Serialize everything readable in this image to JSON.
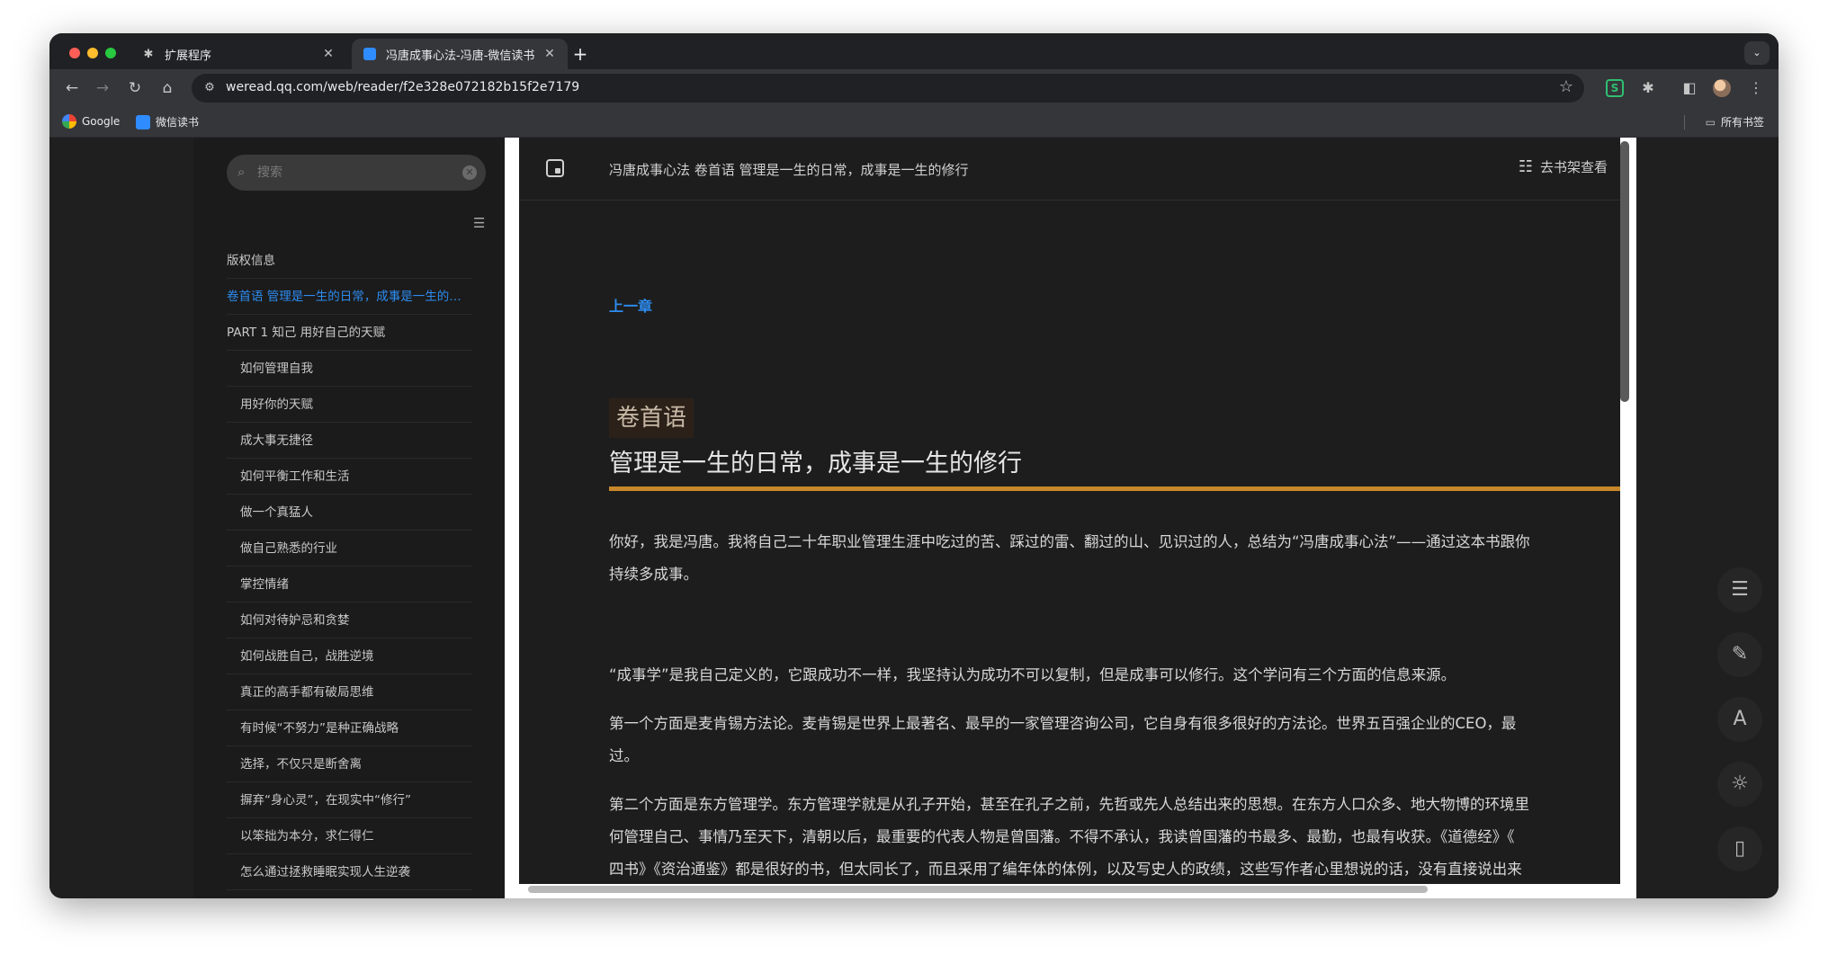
{
  "browser": {
    "tabs": [
      {
        "icon": "puzzle-icon",
        "title": "扩展程序"
      },
      {
        "icon": "weread-icon",
        "title": "冯唐成事心法-冯唐-微信读书"
      }
    ],
    "new_tab": "+",
    "url": "weread.qq.com/web/reader/f2e328e072182b15f2e7179",
    "bookmarks": [
      {
        "icon": "google-icon",
        "label": "Google"
      },
      {
        "icon": "weread-icon",
        "label": "微信读书"
      }
    ],
    "bookmarks_folder": "所有书签"
  },
  "sidebar": {
    "search_placeholder": "搜索",
    "toc": [
      {
        "label": "版权信息",
        "level": 0,
        "active": false
      },
      {
        "label": "卷首语 管理是一生的日常，成事是一生的修行",
        "level": 0,
        "active": true
      },
      {
        "label": "PART 1 知己 用好自己的天赋",
        "level": 0,
        "active": false
      },
      {
        "label": "如何管理自我",
        "level": 1,
        "active": false
      },
      {
        "label": "用好你的天赋",
        "level": 1,
        "active": false
      },
      {
        "label": "成大事无捷径",
        "level": 1,
        "active": false
      },
      {
        "label": "如何平衡工作和生活",
        "level": 1,
        "active": false
      },
      {
        "label": "做一个真猛人",
        "level": 1,
        "active": false
      },
      {
        "label": "做自己熟悉的行业",
        "level": 1,
        "active": false
      },
      {
        "label": "掌控情绪",
        "level": 1,
        "active": false
      },
      {
        "label": "如何对待妒忌和贪婪",
        "level": 1,
        "active": false
      },
      {
        "label": "如何战胜自己，战胜逆境",
        "level": 1,
        "active": false
      },
      {
        "label": "真正的高手都有破局思维",
        "level": 1,
        "active": false
      },
      {
        "label": "有时候“不努力”是种正确战略",
        "level": 1,
        "active": false
      },
      {
        "label": "选择，不仅只是断舍离",
        "level": 1,
        "active": false
      },
      {
        "label": "摒弃“身心灵”，在现实中“修行”",
        "level": 1,
        "active": false
      },
      {
        "label": "以笨拙为本分，求仁得仁",
        "level": 1,
        "active": false
      },
      {
        "label": "怎么通过拯救睡眠实现人生逆袭",
        "level": 1,
        "active": false
      }
    ]
  },
  "reader": {
    "header_title": "冯唐成事心法 卷首语 管理是一生的日常，成事是一生的修行",
    "shelf_label": "去书架查看",
    "prev_chapter": "上一章",
    "chapter_badge": "卷首语",
    "chapter_title": "管理是一生的日常，成事是一生的修行",
    "paragraphs": [
      [
        "你好，我是冯唐。我将自己二十年职业管理生涯中吃过的苦、踩过的雷、翻过的山、见识过的人，总结为“冯唐成事心法”——通过这本书跟你",
        "持续多成事。"
      ],
      [
        "“成事学”是我自己定义的，它跟成功不一样，我坚持认为成功不可以复制，但是成事可以修行。这个学问有三个方面的信息来源。"
      ],
      [
        "第一个方面是麦肯锡方法论。麦肯锡是世界上最著名、最早的一家管理咨询公司，它自身有很多很好的方法论。世界五百强企业的CEO，最",
        "过。"
      ],
      [
        "第二个方面是东方管理学。东方管理学就是从孔子开始，甚至在孔子之前，先哲或先人总结出来的思想。在东方人口众多、地大物博的环境里",
        "何管理自己、事情乃至天下，清朝以后，最重要的代表人物是曾国藩。不得不承认，我读曾国藩的书最多、最勤，也最有收获。《道德经》《",
        "四书》《资治通鉴》都是很好的书，但太同长了，而且采用了编年体的体例，以及写史人的政绩，这些写作者心里想说的话，没有直接说出来"
      ]
    ]
  },
  "floating_tools": [
    {
      "icon": "toc-menu-icon"
    },
    {
      "icon": "note-pen-icon"
    },
    {
      "icon": "font-size-icon",
      "glyph": "A"
    },
    {
      "icon": "brightness-icon"
    },
    {
      "icon": "phone-icon"
    }
  ]
}
